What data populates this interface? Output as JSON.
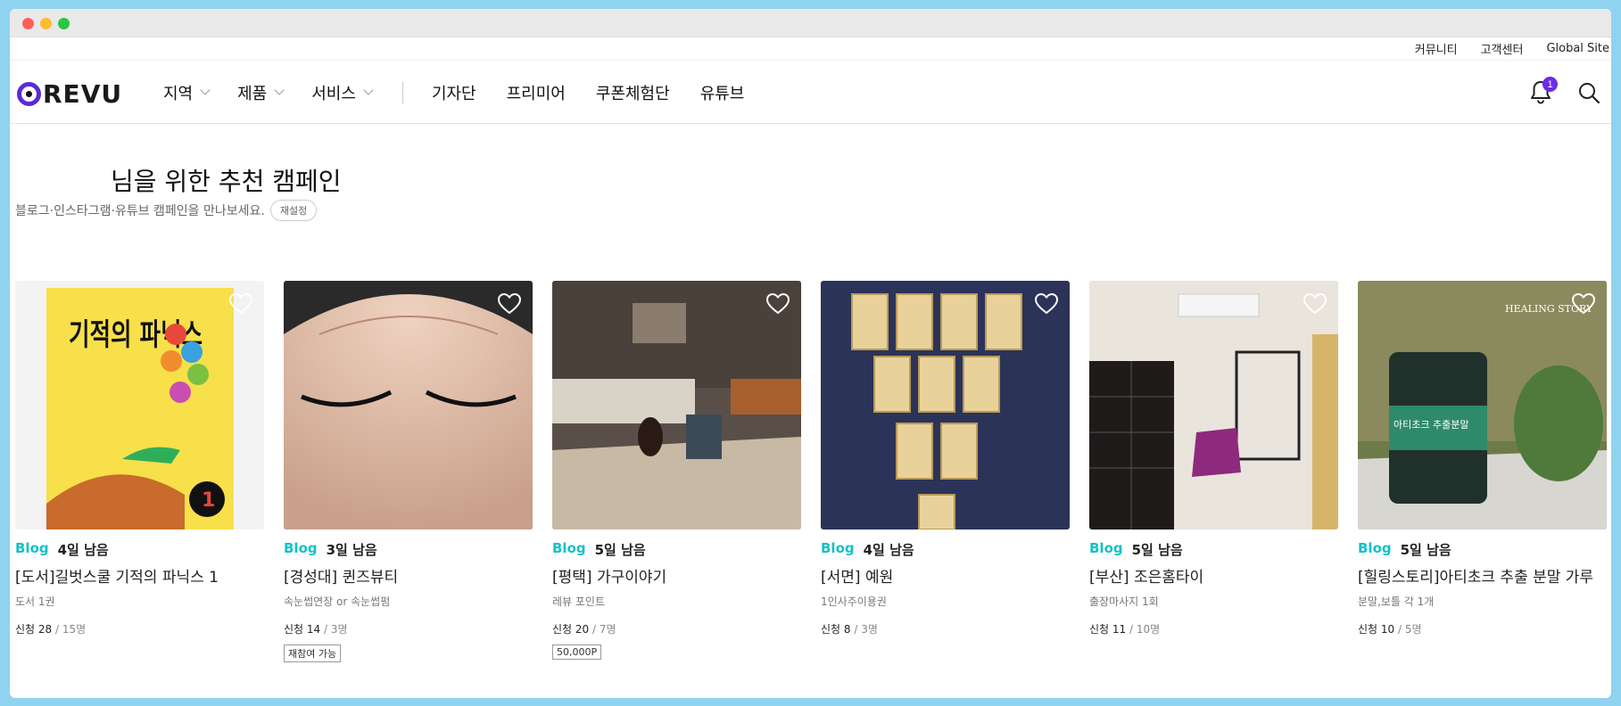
{
  "top_links": [
    "커뮤니티",
    "고객센터",
    "Global Site"
  ],
  "logo": {
    "text": "REVU",
    "color": "#5b2bd6"
  },
  "menu_dropdowns": [
    "지역",
    "제품",
    "서비스"
  ],
  "menu_links": [
    "기자단",
    "프리미어",
    "쿠폰체험단",
    "유튜브"
  ],
  "notification_count": "1",
  "section": {
    "title": "님을 위한 추천 캠페인",
    "subtitle": "블로그·인스타그램·유튜브 캠페인을 만나보세요.",
    "reset_label": "재설정"
  },
  "colors": {
    "accent": "#16c0c8",
    "brand": "#5b2bd6"
  },
  "cards": [
    {
      "channel": "Blog",
      "days": "4일 남음",
      "title": "[도서]길벗스쿨 기적의 파닉스 1",
      "sub": "도서 1권",
      "apply_label": "신청 28",
      "total": " / 15명",
      "tag": ""
    },
    {
      "channel": "Blog",
      "days": "3일 남음",
      "title": "[경성대] 퀸즈뷰티",
      "sub": "속눈썹연장 or 속눈썹펌",
      "apply_label": "신청 14",
      "total": " / 3명",
      "tag": "재참여 가능"
    },
    {
      "channel": "Blog",
      "days": "5일 남음",
      "title": "[평택] 가구이야기",
      "sub": "레뷰 포인트",
      "apply_label": "신청 20",
      "total": " / 7명",
      "tag": "50,000P"
    },
    {
      "channel": "Blog",
      "days": "4일 남음",
      "title": "[서면] 예원",
      "sub": "1인사주이용권",
      "apply_label": "신청 8",
      "total": " / 3명",
      "tag": ""
    },
    {
      "channel": "Blog",
      "days": "5일 남음",
      "title": "[부산] 조은홈타이",
      "sub": "출장마사지 1회",
      "apply_label": "신청 11",
      "total": " / 10명",
      "tag": ""
    },
    {
      "channel": "Blog",
      "days": "5일 남음",
      "title": "[힐링스토리]아티초크 추출 분말 가루",
      "sub": "분말,보틀 각 1개",
      "apply_label": "신청 10",
      "total": " / 5명",
      "tag": ""
    }
  ],
  "thumb_text": {
    "book_title": "기적의 파닉스",
    "book_badge": "1",
    "brand": "HEALING STORY",
    "product": "아티초크 추출분말"
  }
}
